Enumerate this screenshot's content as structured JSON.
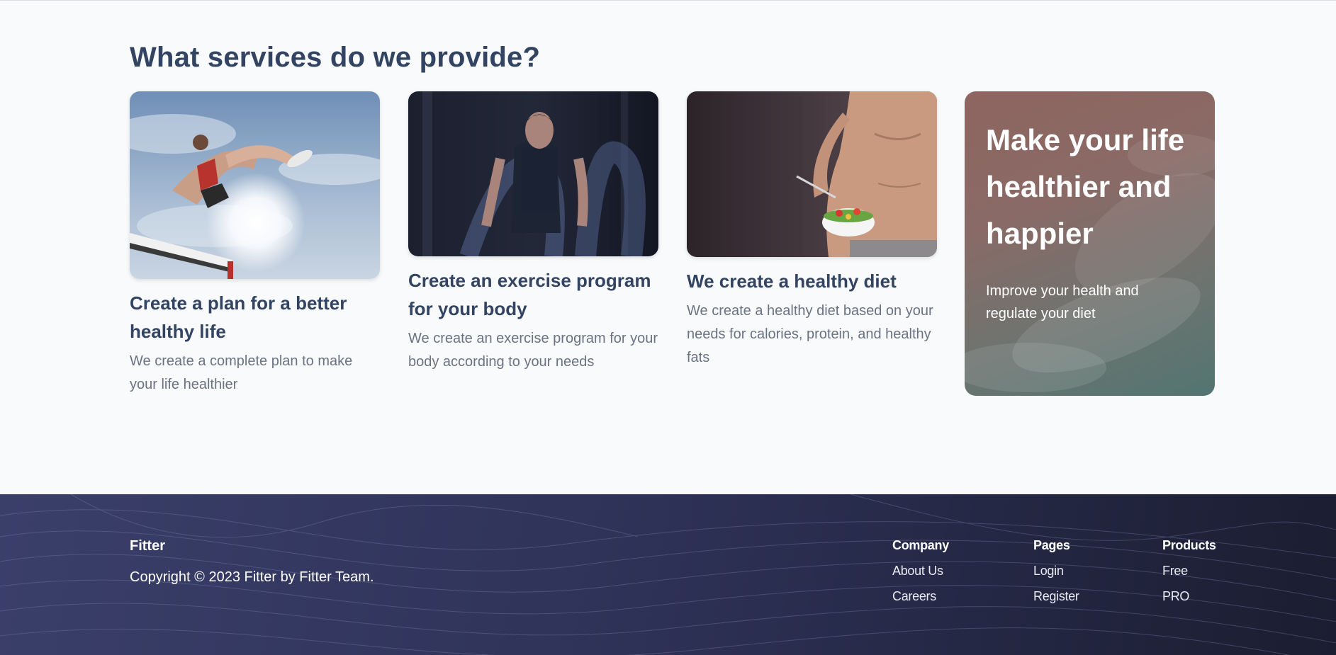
{
  "services": {
    "heading": "What services do we provide?",
    "cards": [
      {
        "title": "Create a plan for a better healthy life",
        "desc": "We create a complete plan to make your life healthier",
        "image_icon": "hurdle-jumper-photo"
      },
      {
        "title": "Create an exercise program for your body",
        "desc": "We create an exercise program for your body according to your needs",
        "image_icon": "battle-ropes-athlete-photo"
      },
      {
        "title": "We create a healthy diet",
        "desc": "We create a healthy diet based on your needs for calories, protein, and healthy fats",
        "image_icon": "salad-bowl-man-photo"
      }
    ],
    "promo": {
      "title": "Make your life healthier and happier",
      "text": "Improve your health and regulate your diet"
    }
  },
  "footer": {
    "brand": "Fitter",
    "copyright": "Copyright © 2023 Fitter by Fitter Team.",
    "columns": [
      {
        "title": "Company",
        "links": [
          "About Us",
          "Careers"
        ]
      },
      {
        "title": "Pages",
        "links": [
          "Login",
          "Register"
        ]
      },
      {
        "title": "Products",
        "links": [
          "Free",
          "PRO"
        ]
      }
    ]
  },
  "colors": {
    "heading": "#334462",
    "body_text": "#6b7383",
    "footer_bg": "#2f3359",
    "page_bg": "#f8fafc"
  }
}
